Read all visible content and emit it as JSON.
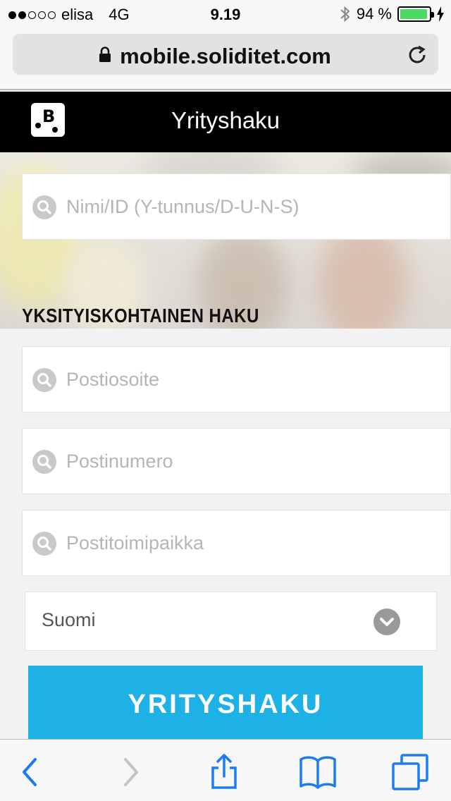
{
  "status_bar": {
    "signal_dots": [
      true,
      true,
      false,
      false,
      false
    ],
    "carrier": "elisa",
    "network": "4G",
    "time": "9.19",
    "bluetooth_icon": "bluetooth-icon",
    "battery_percent": "94 %",
    "battery_level": 0.94,
    "charging_icon": "bolt-icon"
  },
  "browser": {
    "url": "mobile.soliditet.com",
    "lock_icon": "lock-icon",
    "reload_icon": "reload-icon"
  },
  "header": {
    "logo": "B",
    "title": "Yrityshaku"
  },
  "search": {
    "name_placeholder": "Nimi/ID (Y-tunnus/D-U-N-S)"
  },
  "detailed": {
    "title": "YKSITYISKOHTAINEN HAKU",
    "address_placeholder": "Postiosoite",
    "postcode_placeholder": "Postinumero",
    "city_placeholder": "Postitoimipaikka",
    "country_selected": "Suomi",
    "submit_label": "YRITYSHAKU"
  },
  "toolbar": {
    "icons": [
      "back-icon",
      "forward-icon",
      "share-icon",
      "bookmarks-icon",
      "tabs-icon"
    ]
  },
  "colors": {
    "accent": "#1eb1e6",
    "header_bg": "#000000",
    "battery": "#4cd964"
  }
}
